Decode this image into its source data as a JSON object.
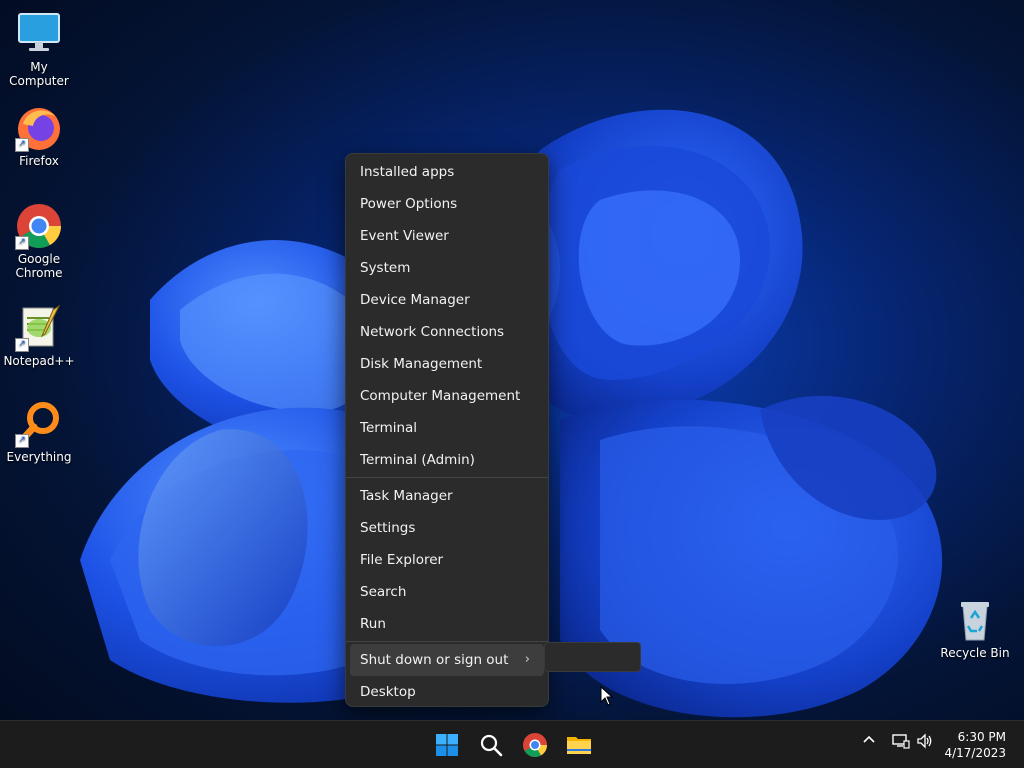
{
  "desktop": {
    "icons": [
      {
        "label": "My Computer"
      },
      {
        "label": "Firefox"
      },
      {
        "label": "Google Chrome"
      },
      {
        "label": "Notepad++"
      },
      {
        "label": "Everything"
      },
      {
        "label": "Recycle Bin"
      }
    ]
  },
  "context_menu": {
    "group1": [
      "Installed apps",
      "Power Options",
      "Event Viewer",
      "System",
      "Device Manager",
      "Network Connections",
      "Disk Management",
      "Computer Management",
      "Terminal",
      "Terminal (Admin)"
    ],
    "group2": [
      "Task Manager",
      "Settings",
      "File Explorer",
      "Search",
      "Run"
    ],
    "shutdown": "Shut down or sign out",
    "desktop": "Desktop"
  },
  "taskbar": {
    "apps": [
      {
        "icon": "windows-start-icon"
      },
      {
        "icon": "search-icon"
      },
      {
        "icon": "chrome-icon"
      },
      {
        "icon": "file-explorer-icon"
      }
    ],
    "clock": {
      "time": "6:30 PM",
      "date": "4/17/2023"
    }
  },
  "colors": {
    "menu_bg": "#2b2b2b",
    "taskbar_bg": "#1c1c1c",
    "accent": "#1a5fd0"
  }
}
